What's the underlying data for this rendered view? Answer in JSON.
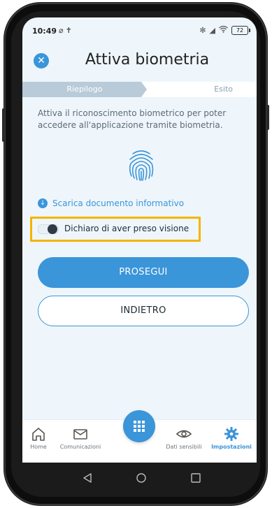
{
  "status_bar": {
    "time": "10:49",
    "battery": "72",
    "icons_left": [
      "alarm-off-icon",
      "accessibility-icon"
    ],
    "icons_right": [
      "bluetooth-icon",
      "signal-icon",
      "wifi-icon",
      "battery-icon"
    ]
  },
  "header": {
    "title": "Attiva biometria",
    "close_icon": "close-icon"
  },
  "stepper": {
    "steps": [
      {
        "label": "Riepilogo",
        "active": true
      },
      {
        "label": "Esito",
        "active": false
      }
    ]
  },
  "main": {
    "description": "Attiva il riconoscimento biometrico per poter accedere all'applicazione tramite biometria.",
    "download_label": "Scarica documento informativo",
    "toggle_label": "Dichiaro di aver preso visione",
    "toggle_checked": false,
    "primary_button": "PROSEGUI",
    "secondary_button": "INDIETRO"
  },
  "bottom_nav": {
    "items": [
      {
        "label": "Home",
        "icon": "home-icon",
        "active": false
      },
      {
        "label": "Comunicazioni",
        "icon": "mail-icon",
        "active": false
      },
      {
        "label": "",
        "icon": "grid-icon",
        "active": false
      },
      {
        "label": "Dati sensibili",
        "icon": "eye-icon",
        "active": false
      },
      {
        "label": "Impostazioni",
        "icon": "gear-icon",
        "active": true
      }
    ]
  },
  "colors": {
    "accent": "#3b95d9",
    "highlight": "#f5b400",
    "background": "#eef6fb"
  }
}
